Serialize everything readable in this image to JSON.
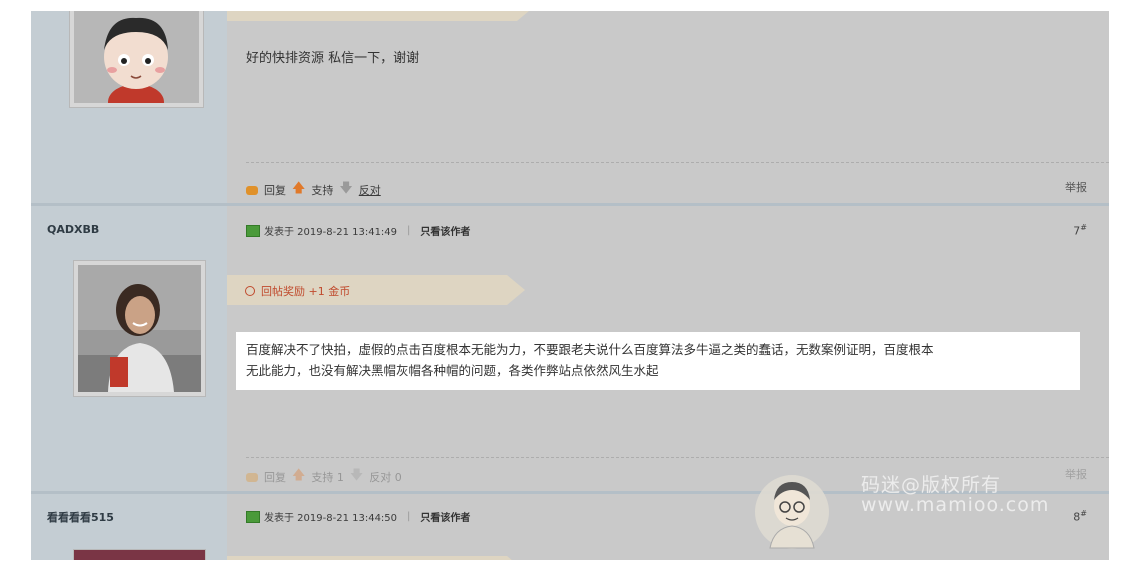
{
  "post6": {
    "text": "好的快排资源 私信一下，谢谢",
    "actions": {
      "reply": "回复",
      "support": "支持",
      "oppose": "反对"
    },
    "report": "举报"
  },
  "post7": {
    "username": "QADXBB",
    "meta_posted": "发表于 2019-8-21 13:41:49",
    "meta_only": "只看该作者",
    "floor": "7",
    "reward": "回帖奖励 +1 金币",
    "text_line1": "百度解决不了快拍，虚假的点击百度根本无能为力，不要跟老夫说什么百度算法多牛逼之类的蠢话，无数案例证明，百度根本",
    "text_line2": "无此能力，也没有解决黑帽灰帽各种帽的问题，各类作弊站点依然风生水起",
    "actions": {
      "reply": "回复",
      "support": "支持 1",
      "oppose": "反对 0"
    },
    "report": "举报"
  },
  "post8": {
    "username": "看看看看515",
    "meta_posted": "发表于 2019-8-21 13:44:50",
    "meta_only": "只看该作者",
    "floor": "8"
  },
  "watermark": {
    "line1": "码迷@版权所有",
    "line2": "www.mamioo.com"
  }
}
